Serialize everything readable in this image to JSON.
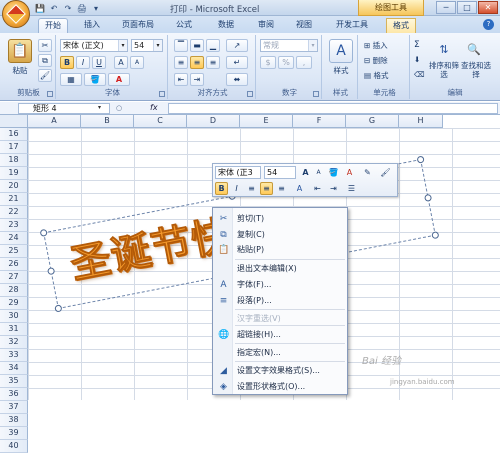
{
  "window": {
    "title": "打印 - Microsoft Excel",
    "context_tab": "绘图工具",
    "minimize": "─",
    "maximize": "□",
    "close": "✕"
  },
  "qat": {
    "save": "💾",
    "undo": "↶",
    "redo": "↷",
    "print": "🖨",
    "more": "▾"
  },
  "tabs": [
    "开始",
    "插入",
    "页面布局",
    "公式",
    "数据",
    "审阅",
    "视图",
    "开发工具",
    "格式"
  ],
  "active_tab": "开始",
  "ribbon": {
    "clipboard": {
      "label": "剪贴板",
      "paste": "粘贴"
    },
    "font": {
      "label": "字体",
      "font_name": "宋体 (正文)",
      "font_size": "54",
      "bold": "B",
      "italic": "I",
      "underline": "U",
      "grow": "A",
      "shrink": "A",
      "font_color": "A"
    },
    "alignment": {
      "label": "对齐方式"
    },
    "number": {
      "label": "数字",
      "format": "常规",
      "percent": "%",
      "comma": ",",
      "currency": "$"
    },
    "styles": {
      "label": "样式",
      "button": "样式"
    },
    "cells": {
      "label": "单元格",
      "insert": "插入",
      "delete": "删除",
      "format": "格式"
    },
    "editing": {
      "label": "编辑",
      "sum": "Σ",
      "sort": "排序和筛选",
      "find": "查找和选择"
    }
  },
  "formula_bar": {
    "name_box": "矩形 4",
    "fx": "fx",
    "value": ""
  },
  "grid": {
    "columns": [
      "A",
      "B",
      "C",
      "D",
      "E",
      "F",
      "G",
      "H"
    ],
    "rows": [
      "16",
      "17",
      "18",
      "19",
      "20",
      "21",
      "22",
      "23",
      "24",
      "25",
      "26",
      "27",
      "28",
      "29",
      "30",
      "31",
      "32",
      "33",
      "34",
      "35",
      "36",
      "37",
      "38",
      "39",
      "40"
    ]
  },
  "shape": {
    "text": "圣诞节快乐"
  },
  "mini_toolbar": {
    "font_name": "宋体 (正3",
    "font_size": "54",
    "grow": "A",
    "shrink": "A",
    "bold": "B",
    "italic": "I"
  },
  "context_menu": {
    "items": [
      {
        "label": "剪切(T)",
        "icon": "scissors-icon",
        "glyph": "✂",
        "disabled": false
      },
      {
        "label": "复制(C)",
        "icon": "copy-icon",
        "glyph": "⧉",
        "disabled": false
      },
      {
        "label": "粘贴(P)",
        "icon": "paste-icon",
        "glyph": "📋",
        "disabled": false
      },
      {
        "label": "退出文本编辑(X)",
        "icon": "",
        "glyph": "",
        "disabled": false
      },
      {
        "label": "字体(F)...",
        "icon": "font-icon",
        "glyph": "A",
        "disabled": false
      },
      {
        "label": "段落(P)...",
        "icon": "paragraph-icon",
        "glyph": "≡",
        "disabled": false
      },
      {
        "label": "汉字重选(V)",
        "icon": "",
        "glyph": "",
        "disabled": true
      },
      {
        "label": "超链接(H)...",
        "icon": "hyperlink-icon",
        "glyph": "🌐",
        "disabled": false
      },
      {
        "label": "指定宏(N)...",
        "icon": "",
        "glyph": "",
        "disabled": false
      },
      {
        "label": "设置文字效果格式(S)...",
        "icon": "text-effects-icon",
        "glyph": "◢",
        "disabled": false
      },
      {
        "label": "设置形状格式(O)...",
        "icon": "shape-format-icon",
        "glyph": "◈",
        "disabled": false
      }
    ]
  },
  "watermark": {
    "text": "Bai 经验",
    "sub": "jingyan.baidu.com"
  },
  "colors": {
    "wordart": "#f59a2c",
    "ribbon": "#dce7f6",
    "accent": "#ffc957"
  }
}
